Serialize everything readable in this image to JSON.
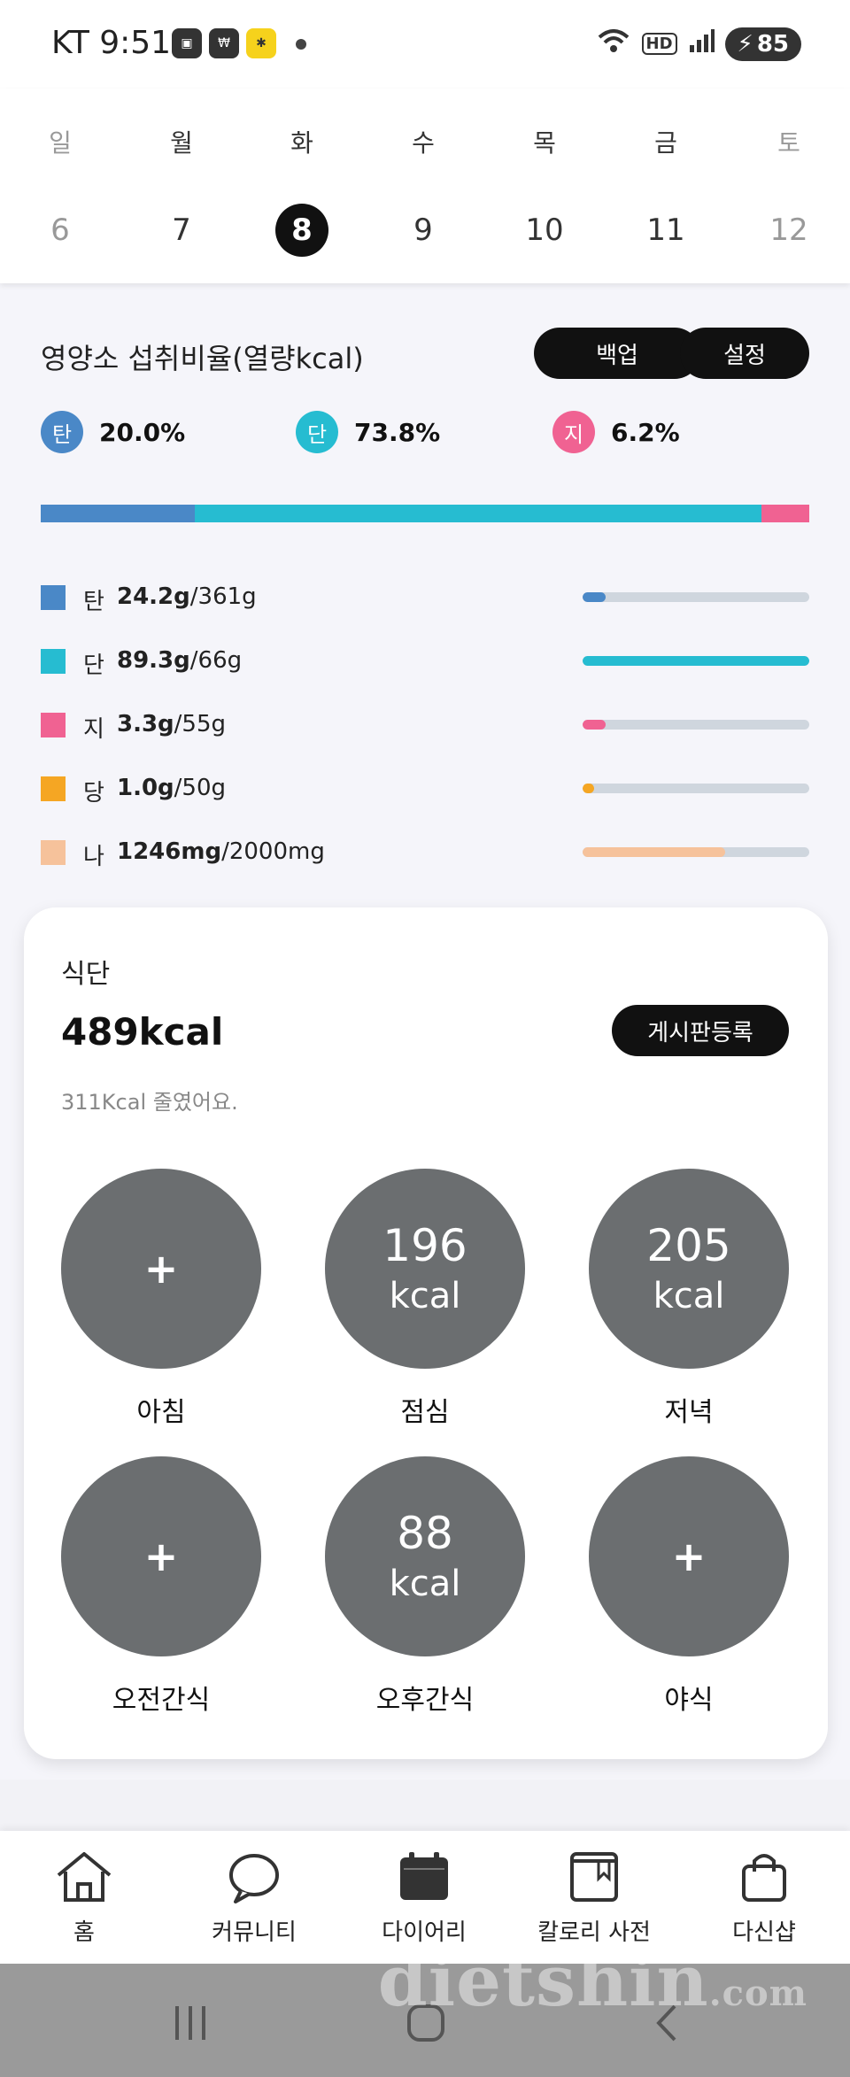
{
  "status_bar": {
    "carrier_time": "KT 9:51",
    "battery": "85"
  },
  "week": {
    "days": [
      {
        "name": "일",
        "num": "6"
      },
      {
        "name": "월",
        "num": "7"
      },
      {
        "name": "화",
        "num": "8"
      },
      {
        "name": "수",
        "num": "9"
      },
      {
        "name": "목",
        "num": "10"
      },
      {
        "name": "금",
        "num": "11"
      },
      {
        "name": "토",
        "num": "12"
      }
    ],
    "selected": "8"
  },
  "nutrition": {
    "title": "영양소 섭취비율(열량kcal)",
    "backup_label": "백업",
    "settings_label": "설정",
    "ratios": [
      {
        "key": "탄",
        "pct": "20.0%",
        "color": "#4a88c7"
      },
      {
        "key": "단",
        "pct": "73.8%",
        "color": "#26bcd1"
      },
      {
        "key": "지",
        "pct": "6.2%",
        "color": "#f06292"
      }
    ],
    "rows": [
      {
        "label": "탄",
        "value": "24.2g",
        "target": "/361g",
        "color": "#4a88c7",
        "fill": 0.1
      },
      {
        "label": "단",
        "value": "89.3g",
        "target": "/66g",
        "color": "#26bcd1",
        "fill": 1.0
      },
      {
        "label": "지",
        "value": "3.3g",
        "target": "/55g",
        "color": "#f06292",
        "fill": 0.1
      },
      {
        "label": "당",
        "value": "1.0g",
        "target": "/50g",
        "color": "#f5a623",
        "fill": 0.05
      },
      {
        "label": "나",
        "value": "1246mg",
        "target": "/2000mg",
        "color": "#f6c29b",
        "fill": 0.63
      }
    ]
  },
  "diet": {
    "title": "식단",
    "total": "489kcal",
    "register_label": "게시판등록",
    "subtitle": "311Kcal 줄였어요.",
    "meals": [
      {
        "name": "아침",
        "plus": "+",
        "value": "",
        "unit": ""
      },
      {
        "name": "점심",
        "plus": "",
        "value": "196",
        "unit": "kcal"
      },
      {
        "name": "저녁",
        "plus": "",
        "value": "205",
        "unit": "kcal"
      },
      {
        "name": "오전간식",
        "plus": "+",
        "value": "",
        "unit": ""
      },
      {
        "name": "오후간식",
        "plus": "",
        "value": "88",
        "unit": "kcal"
      },
      {
        "name": "야식",
        "plus": "+",
        "value": "",
        "unit": ""
      }
    ]
  },
  "bottom_nav": {
    "items": [
      {
        "label": "홈",
        "icon": "home-icon"
      },
      {
        "label": "커뮤니티",
        "icon": "chat-bubble-icon"
      },
      {
        "label": "다이어리",
        "icon": "calendar-icon"
      },
      {
        "label": "칼로리 사전",
        "icon": "book-icon"
      },
      {
        "label": "다신샵",
        "icon": "shopping-bag-icon"
      }
    ]
  },
  "watermark": {
    "main": "dietshin",
    "suffix": ".com"
  }
}
